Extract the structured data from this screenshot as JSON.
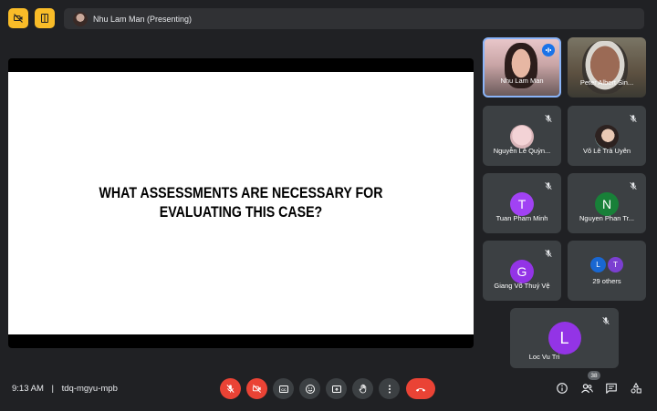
{
  "presentation": {
    "presenter_label": "Nhu Lam Man (Presenting)",
    "slide_title": "WHAT ASSESSMENTS ARE NECESSARY FOR EVALUATING THIS CASE?"
  },
  "participants": [
    {
      "name": "Nhu Lam Man",
      "type": "video",
      "speaking": true
    },
    {
      "name": "Peter Albert Sin...",
      "type": "video"
    },
    {
      "name": "Nguyễn Lê Quỳn...",
      "type": "photo",
      "muted": true
    },
    {
      "name": "Võ Lê Trà Uyên",
      "type": "photo",
      "muted": true
    },
    {
      "name": "Tuan Pham Minh",
      "initial": "T",
      "color": "#a142f4",
      "muted": true
    },
    {
      "name": "Nguyen Phan Tr...",
      "initial": "N",
      "color": "#188038",
      "muted": true
    },
    {
      "name": "Giang Võ Thuý Vệ",
      "initial": "G",
      "color": "#9334e6",
      "muted": true
    },
    {
      "name": "Loc Vu Tri",
      "initial": "L",
      "color": "#9334e6",
      "muted": true
    }
  ],
  "others_tile": {
    "label": "29 others",
    "avatars": [
      {
        "initial": "L",
        "color": "#1967d2"
      },
      {
        "initial": "T",
        "color": "#7b3fd1"
      }
    ]
  },
  "meeting": {
    "time": "9:13 AM",
    "separator": "|",
    "code": "tdq-mgyu-mpb",
    "participant_count": "38"
  },
  "colors": {
    "background": "#202124",
    "tile": "#3c4043",
    "accent_yellow": "#f9bc28",
    "danger": "#ea4335"
  }
}
